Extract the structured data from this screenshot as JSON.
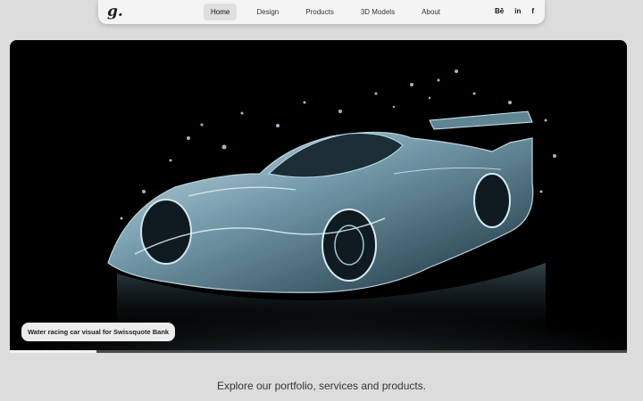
{
  "nav": {
    "logo": "g.",
    "links": [
      {
        "label": "Home",
        "active": true
      },
      {
        "label": "Design"
      },
      {
        "label": "Products"
      },
      {
        "label": "3D Models"
      },
      {
        "label": "About"
      }
    ],
    "socials": {
      "behance": "Bē",
      "linkedin": "in",
      "facebook": "f"
    }
  },
  "hero": {
    "caption": "Water racing car visual for Swissquote Bank",
    "slide_progress": 0.14
  },
  "tagline": "Explore our portfolio, services and products.",
  "colors": {
    "page_bg": "#dcdcdc",
    "nav_bg": "#f4f4f4",
    "active_link_bg": "#dedede",
    "hero_bg": "#000000",
    "water_tint": "#9fc6d8"
  }
}
